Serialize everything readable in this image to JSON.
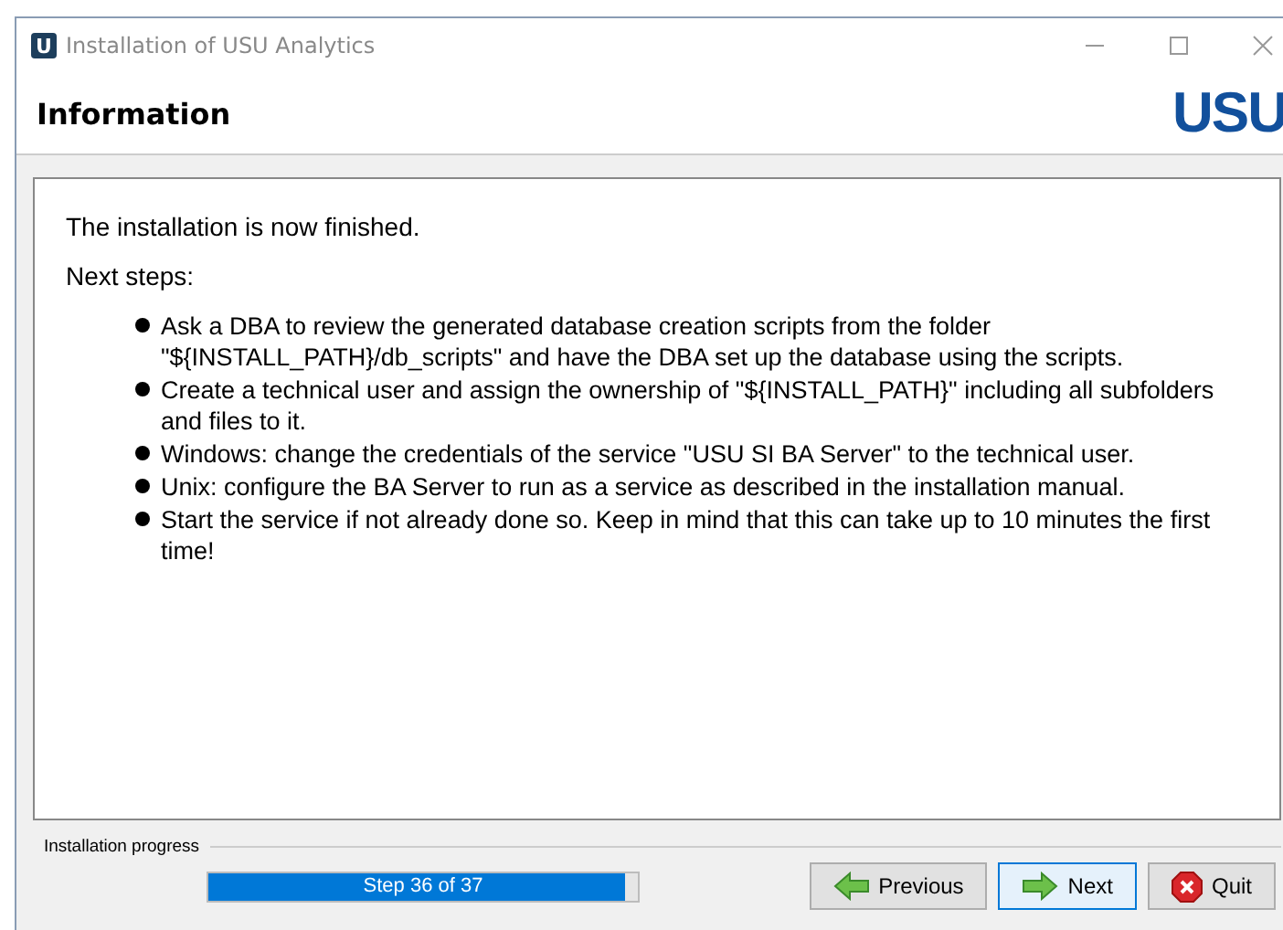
{
  "window": {
    "title": "Installation of USU Analytics",
    "app_icon": "U"
  },
  "header": {
    "title": "Information",
    "logo": "USU"
  },
  "content": {
    "intro": "The installation is now finished.",
    "heading": "Next steps:",
    "steps": [
      "Ask a DBA to review the generated database creation scripts from the folder \"${INSTALL_PATH}/db_scripts\" and have the DBA set up the database using the scripts.",
      "Create a technical user and assign the ownership of \"${INSTALL_PATH}\" including all subfolders and files to it.",
      "Windows: change the credentials of the service \"USU SI BA Server\" to the technical user.",
      "Unix: configure the BA Server to run as a service as described in the installation manual.",
      "Start the service if not already done so. Keep in mind that this can take up to 10 minutes the first time!"
    ]
  },
  "progress": {
    "label": "Installation progress",
    "text": "Step 36 of 37",
    "level": 0.97
  },
  "buttons": [
    {
      "label": "Previous",
      "kind": "previous",
      "focused": false
    },
    {
      "label": "Next",
      "kind": "next",
      "focused": true
    },
    {
      "label": "Quit",
      "kind": "quit",
      "focused": false
    }
  ]
}
